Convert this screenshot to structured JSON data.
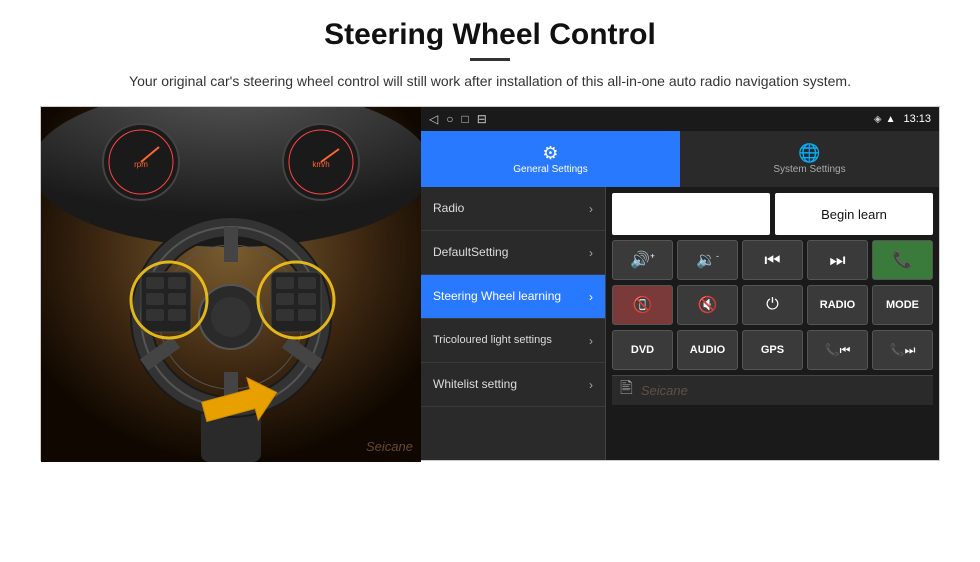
{
  "page": {
    "title": "Steering Wheel Control",
    "divider": true,
    "subtitle": "Your original car's steering wheel control will still work after installation of this all-in-one auto radio navigation system."
  },
  "status_bar": {
    "time": "13:13",
    "icons": [
      "◁",
      "○",
      "□",
      "⊟"
    ]
  },
  "tabs": [
    {
      "id": "general",
      "label": "General Settings",
      "icon": "⚙",
      "active": true
    },
    {
      "id": "system",
      "label": "System Settings",
      "icon": "🌐",
      "active": false
    }
  ],
  "menu": {
    "items": [
      {
        "id": "radio",
        "label": "Radio",
        "active": false
      },
      {
        "id": "default-setting",
        "label": "DefaultSetting",
        "active": false
      },
      {
        "id": "steering-wheel",
        "label": "Steering Wheel learning",
        "active": true
      },
      {
        "id": "tricoloured",
        "label": "Tricoloured light settings",
        "active": false
      },
      {
        "id": "whitelist",
        "label": "Whitelist setting",
        "active": false
      }
    ]
  },
  "controls": {
    "begin_learn_label": "Begin learn",
    "buttons_row1": [
      {
        "id": "vol-up",
        "label": "🔊+",
        "symbol": "🔊+"
      },
      {
        "id": "vol-down",
        "label": "🔉-",
        "symbol": "🔉-"
      },
      {
        "id": "prev",
        "label": "⏮",
        "symbol": "⏮"
      },
      {
        "id": "next",
        "label": "⏭",
        "symbol": "⏭"
      },
      {
        "id": "phone",
        "label": "📞",
        "symbol": "📞"
      }
    ],
    "buttons_row2": [
      {
        "id": "hangup",
        "label": "📵",
        "symbol": "📵"
      },
      {
        "id": "mute",
        "label": "🔇",
        "symbol": "🔇"
      },
      {
        "id": "power",
        "label": "⏻",
        "symbol": "⏻"
      },
      {
        "id": "radio",
        "label": "RADIO",
        "symbol": "RADIO"
      },
      {
        "id": "mode",
        "label": "MODE",
        "symbol": "MODE"
      }
    ],
    "buttons_row3": [
      {
        "id": "dvd",
        "label": "DVD",
        "symbol": "DVD"
      },
      {
        "id": "audio",
        "label": "AUDIO",
        "symbol": "AUDIO"
      },
      {
        "id": "gps",
        "label": "GPS",
        "symbol": "GPS"
      },
      {
        "id": "tel-prev",
        "label": "📞⏮",
        "symbol": "📞⏮"
      },
      {
        "id": "tel-next",
        "label": "📞⏭",
        "symbol": "📞⏭"
      }
    ]
  },
  "watermark": "Seicane"
}
